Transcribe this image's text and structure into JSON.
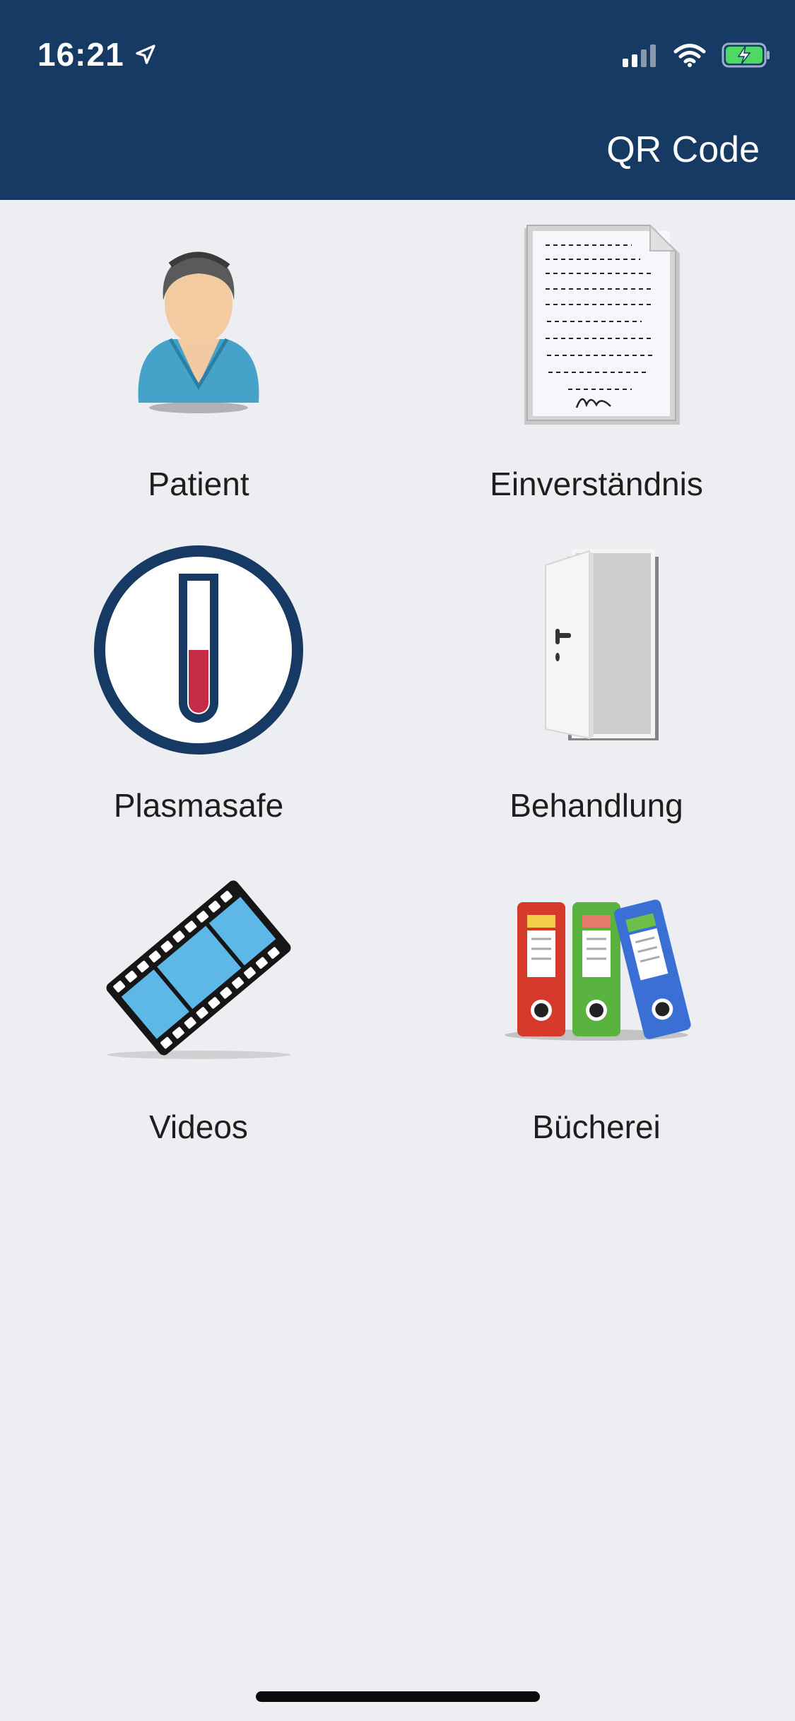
{
  "status_bar": {
    "time": "16:21",
    "icons": [
      "location-arrow-icon",
      "cellular-signal-icon",
      "wifi-icon",
      "battery-charging-icon"
    ]
  },
  "header": {
    "action_label": "QR Code",
    "background_color": "#173a64"
  },
  "menu": {
    "items": [
      {
        "label": "Patient",
        "icon": "patient-icon"
      },
      {
        "label": "Einverständnis",
        "icon": "consent-document-icon"
      },
      {
        "label": "Plasmasafe",
        "icon": "test-tube-icon"
      },
      {
        "label": "Behandlung",
        "icon": "open-door-icon"
      },
      {
        "label": "Videos",
        "icon": "film-strip-icon"
      },
      {
        "label": "Bücherei",
        "icon": "binders-icon"
      }
    ]
  }
}
